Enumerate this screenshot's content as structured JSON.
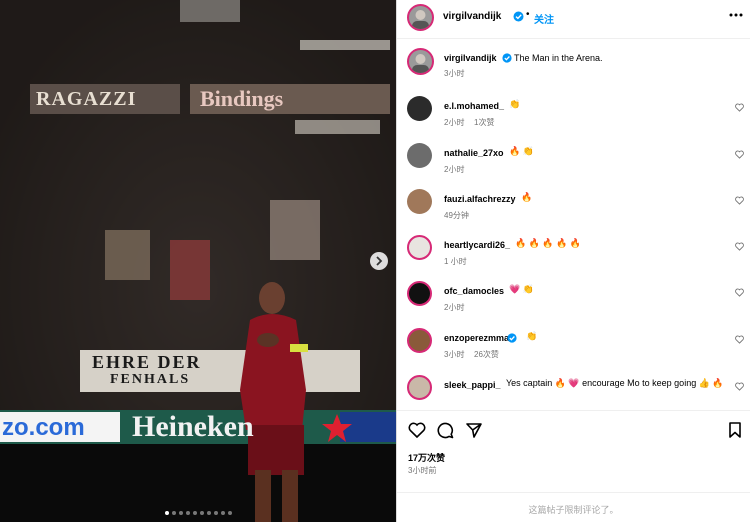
{
  "header": {
    "username": "virgilvandijk",
    "follow_label": "关注",
    "more_icon": "more-horizontal-icon"
  },
  "caption": {
    "username": "virgilvandijk",
    "text": "The Man in the Arena.",
    "time": "3小时"
  },
  "comments": [
    {
      "username": "e.l.mohamed_",
      "text": "👏",
      "time": "2小时",
      "likes": "1次赞",
      "avatar_color": "#2b2b2b",
      "ring": false
    },
    {
      "username": "nathalie_27xo",
      "text": "🔥 👏",
      "time": "2小时",
      "likes": "",
      "avatar_color": "#6c6c6c",
      "ring": false
    },
    {
      "username": "fauzi.alfachrezzy",
      "text": "🔥",
      "time": "49分钟",
      "likes": "",
      "avatar_color": "#a0785a",
      "ring": false
    },
    {
      "username": "heartlycardi26_",
      "text": "🔥 🔥 🔥 🔥 🔥",
      "time": "1 小时",
      "likes": "",
      "avatar_color": "#e8e4e0",
      "ring": true
    },
    {
      "username": "ofc_damocles",
      "text": "💗 👏",
      "time": "2小时",
      "likes": "",
      "avatar_color": "#111111",
      "ring": true
    },
    {
      "username": "enzoperezmma",
      "text": "👏",
      "time": "3小时",
      "likes": "26次赞",
      "avatar_color": "#8a5a3a",
      "ring": true,
      "verified": true
    },
    {
      "username": "sleek_pappi_",
      "text": "Yes captain 🔥 💗 encourage Mo to keep going 👍 🔥",
      "time": "",
      "likes": "",
      "avatar_color": "#c9b8a8",
      "ring": true
    }
  ],
  "actions": {
    "like_icon": "heart-icon",
    "comment_icon": "comment-icon",
    "share_icon": "send-icon",
    "save_icon": "bookmark-icon"
  },
  "likes_count": "17万次赞",
  "post_time": "3小时前",
  "restricted_note": "这篇帖子限制评论了。",
  "photo": {
    "banner_top_left": "RAGAZZI",
    "banner_top_right": "Bindings",
    "banner_mid": "EHRE DER",
    "banner_mid2": "FENHALS",
    "ad_left": "zo.com",
    "ad_main": "Heineken",
    "slide_count": 10,
    "active_slide": 0
  }
}
